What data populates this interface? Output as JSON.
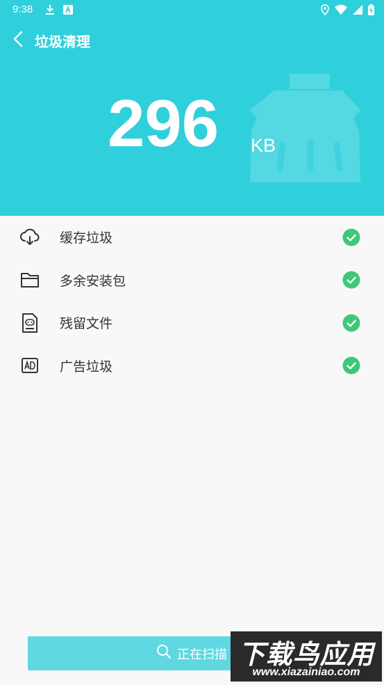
{
  "status_bar": {
    "time": "9:38",
    "left_icons": [
      "download-icon",
      "a-icon"
    ],
    "right_icons": [
      "location-icon",
      "wifi-icon",
      "signal-icon",
      "battery-icon"
    ]
  },
  "toolbar": {
    "back_icon": "chevron-left-icon",
    "title": "垃圾清理"
  },
  "summary": {
    "size_value": "296",
    "size_unit": "KB"
  },
  "items": [
    {
      "icon": "cloud-icon",
      "label": "缓存垃圾",
      "checked": true
    },
    {
      "icon": "folder-icon",
      "label": "多余安装包",
      "checked": true
    },
    {
      "icon": "apk-file-icon",
      "label": "残留文件",
      "checked": true
    },
    {
      "icon": "ad-icon",
      "label": "广告垃圾",
      "checked": true
    }
  ],
  "scan_button": {
    "icon": "search-icon",
    "label": "正在扫描"
  },
  "watermark": {
    "title": "下载鸟应用",
    "url": "www.xiazainiao.com"
  },
  "colors": {
    "header_bg": "#2fd0dc",
    "check_green": "#3ec87a",
    "button_bg": "#5fd8e2"
  }
}
